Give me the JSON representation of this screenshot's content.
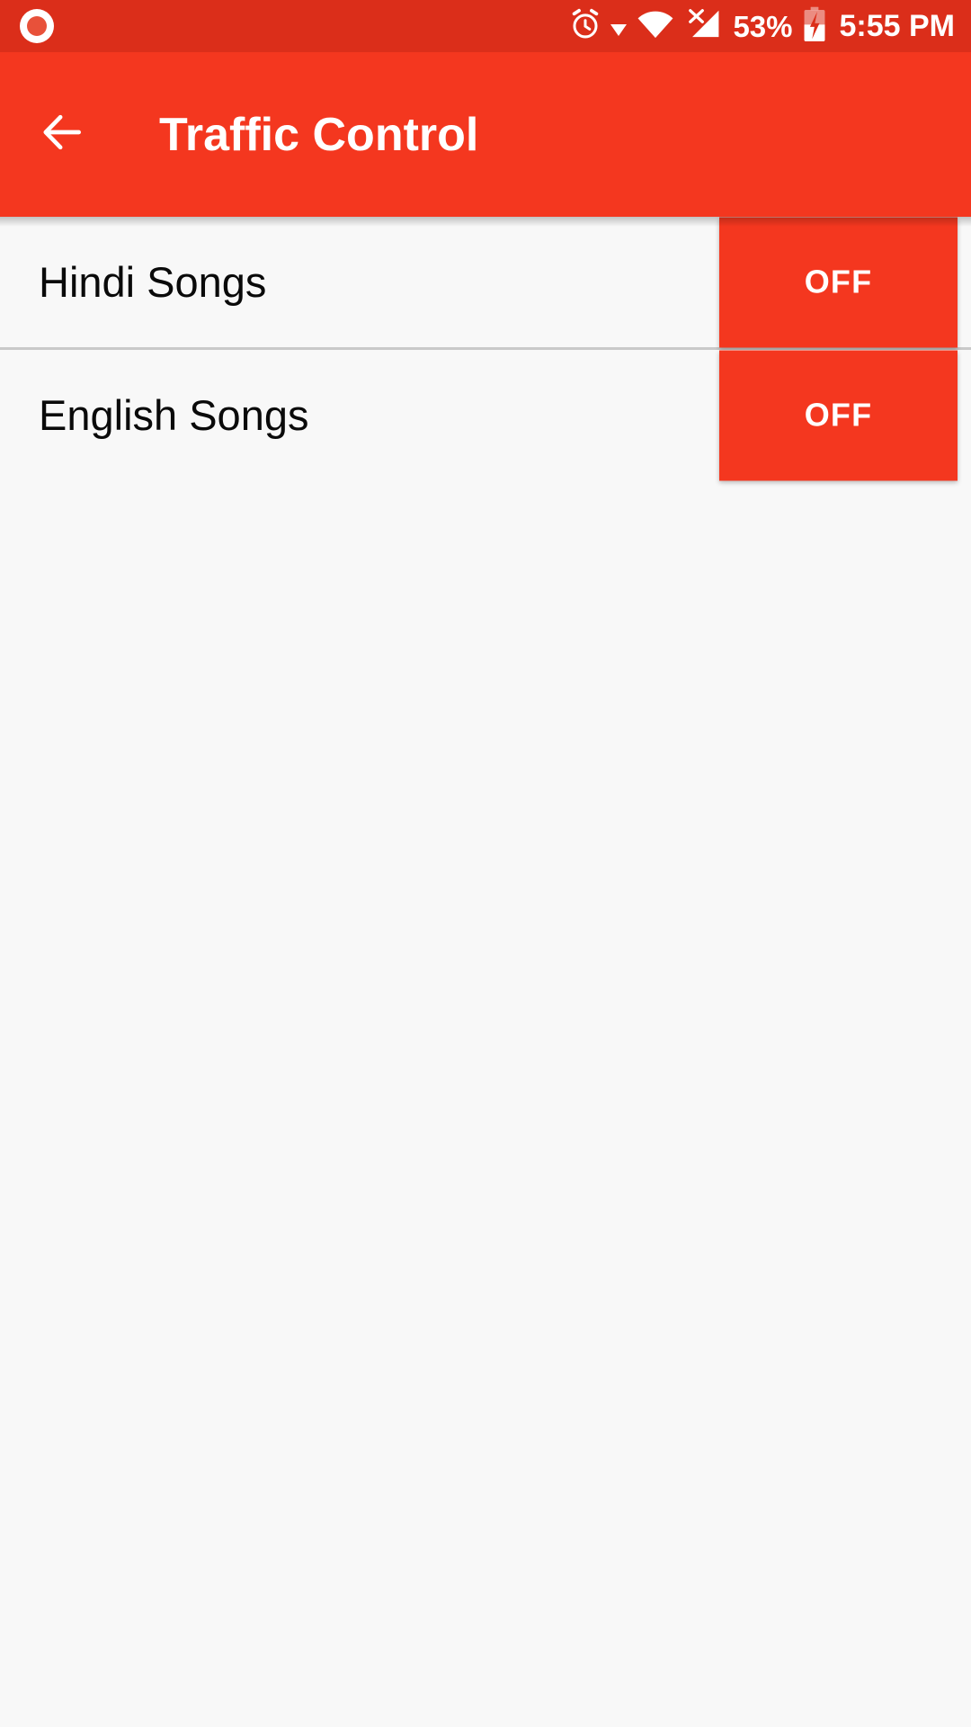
{
  "status_bar": {
    "notification_icon": "record-circle-icon",
    "alarm_icon": "alarm-clock-icon",
    "caret_icon": "dropdown-caret-icon",
    "wifi_icon": "wifi-full-icon",
    "signal_icon": "no-signal-x-icon",
    "battery_percent": "53%",
    "battery_icon": "battery-charging-icon",
    "time": "5:55 PM",
    "background_color": "#DB2E1A",
    "foreground_color": "#FFFFFF"
  },
  "app_bar": {
    "back_icon": "back-arrow-icon",
    "title": "Traffic Control",
    "background_color": "#F4371F",
    "title_color": "#FFFFFF"
  },
  "theme": {
    "accent_color": "#F4371F",
    "page_background": "#F8F8F8",
    "divider_color": "#C9C9C9",
    "primary_text_color": "#0A0A0A"
  },
  "list": {
    "rows": [
      {
        "label": "Hindi Songs",
        "toggle_label": "OFF",
        "state": "off"
      },
      {
        "label": "English Songs",
        "toggle_label": "OFF",
        "state": "off"
      }
    ]
  }
}
